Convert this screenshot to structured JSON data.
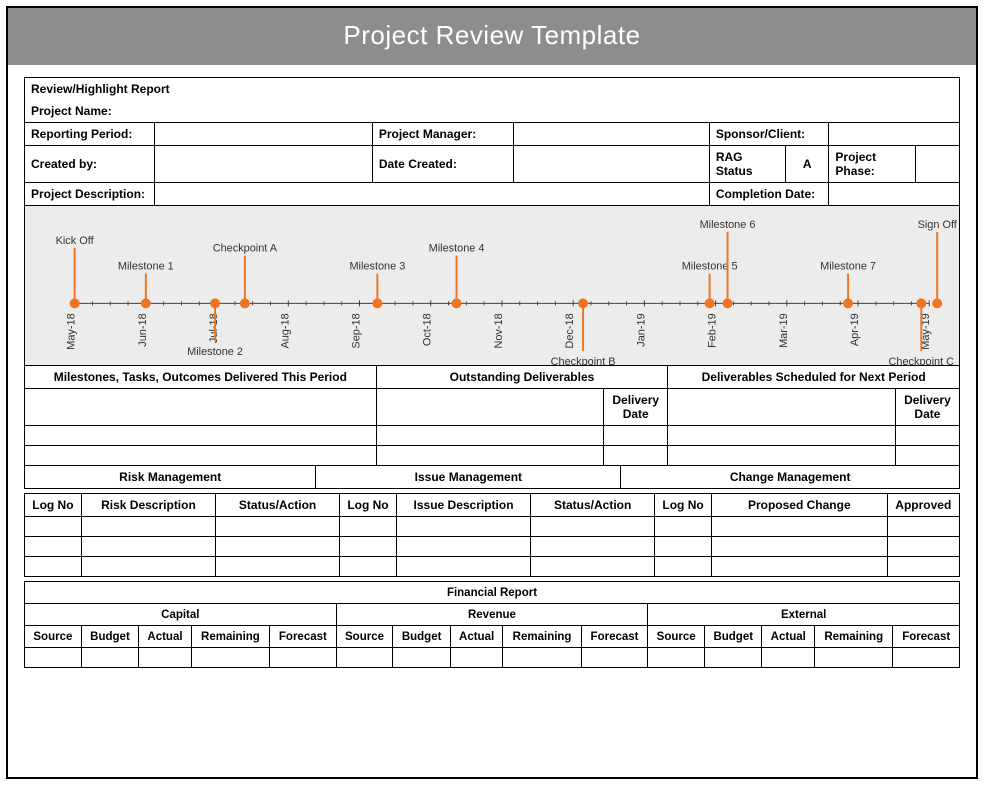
{
  "banner": "Project Review Template",
  "report_heading": "Review/Highlight Report",
  "fields": {
    "project_name": "Project Name:",
    "reporting_period": "Reporting Period:",
    "project_manager": "Project Manager:",
    "sponsor_client": "Sponsor/Client:",
    "created_by": "Created by:",
    "date_created": "Date Created:",
    "rag_status": "RAG Status",
    "rag_value": "A",
    "project_phase": "Project Phase:",
    "project_description": "Project Description:",
    "completion_date": "Completion Date:"
  },
  "timeline": {
    "months": [
      "May-18",
      "Jun-18",
      "Jul-18",
      "Aug-18",
      "Sep-18",
      "Oct-18",
      "Nov-18",
      "Dec-18",
      "Jan-19",
      "Feb-19",
      "Mar-19",
      "Apr-19",
      "May-19"
    ],
    "events": [
      {
        "label": "Kick Off",
        "month_idx": 0,
        "stem": 56,
        "offset": 0,
        "label_dy": 0
      },
      {
        "label": "Milestone 1",
        "month_idx": 1,
        "stem": 30,
        "offset": 0,
        "label_dy": 0
      },
      {
        "label": "Milestone 2",
        "month_idx": 2,
        "stem": -38,
        "offset": -2,
        "label_dy": 0
      },
      {
        "label": "Checkpoint A",
        "month_idx": 2,
        "stem": 48,
        "offset": 28,
        "label_dy": 0
      },
      {
        "label": "Milestone 3",
        "month_idx": 4,
        "stem": 30,
        "offset": 18,
        "label_dy": 0
      },
      {
        "label": "Milestone 4",
        "month_idx": 5,
        "stem": 48,
        "offset": 26,
        "label_dy": 0
      },
      {
        "label": "Checkpoint B",
        "month_idx": 7,
        "stem": -48,
        "offset": 10,
        "label_dy": 0
      },
      {
        "label": "Milestone 5",
        "month_idx": 9,
        "stem": 30,
        "offset": -6,
        "label_dy": 0
      },
      {
        "label": "Milestone 6",
        "month_idx": 9,
        "stem": 72,
        "offset": 12,
        "label_dy": 0
      },
      {
        "label": "Milestone 7",
        "month_idx": 11,
        "stem": 30,
        "offset": -10,
        "label_dy": 0
      },
      {
        "label": "Checkpoint C",
        "month_idx": 12,
        "stem": -48,
        "offset": -8,
        "label_dy": 0
      },
      {
        "label": "Sign Off",
        "month_idx": 12,
        "stem": 72,
        "offset": 8,
        "label_dy": 0
      }
    ]
  },
  "deliverables": {
    "col1": "Milestones, Tasks, Outcomes Delivered This Period",
    "col2": "Outstanding Deliverables",
    "col3": "Deliverables Scheduled for Next Period",
    "delivery_date": "Delivery Date"
  },
  "mgmt": {
    "risk": "Risk Management",
    "issue": "Issue Management",
    "change": "Change Management",
    "log_no": "Log No",
    "risk_desc": "Risk Description",
    "status_action": "Status/Action",
    "issue_desc": "Issue Description",
    "proposed_change": "Proposed Change",
    "approved": "Approved"
  },
  "financial": {
    "title": "Financial Report",
    "capital": "Capital",
    "revenue": "Revenue",
    "external": "External",
    "source": "Source",
    "budget": "Budget",
    "actual": "Actual",
    "remaining": "Remaining",
    "forecast": "Forecast"
  }
}
